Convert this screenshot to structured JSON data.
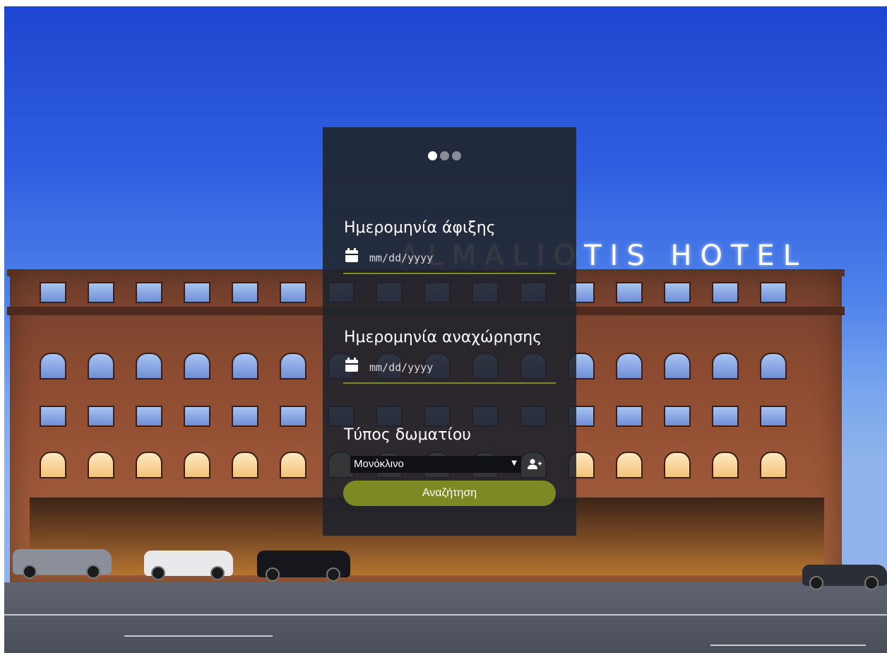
{
  "background": {
    "sign_text": "ALMALIOTIS HOTEL"
  },
  "slider": {
    "dot_count": 3,
    "active_index": 0
  },
  "booking": {
    "arrival": {
      "label": "Ημερομηνία άφιξης",
      "placeholder": "mm/dd/yyyy",
      "icon": "calendar-icon"
    },
    "departure": {
      "label": "Ημερομηνία αναχώρησης",
      "placeholder": "mm/dd/yyyy",
      "icon": "calendar-icon"
    },
    "room_type": {
      "label": "Τύπος δωματίου",
      "selected": "Μονόκλινο",
      "add_icon": "add-person-icon"
    },
    "search_label": "Αναζήτηση"
  },
  "colors": {
    "panel_bg": "#20232c",
    "accent": "#7d8a23",
    "underline": "#7f8a22"
  }
}
